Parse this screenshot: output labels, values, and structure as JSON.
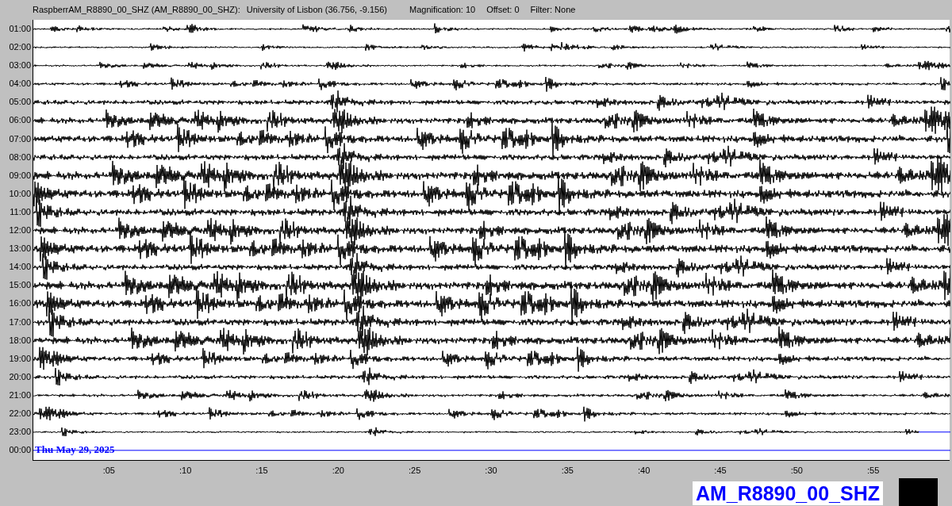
{
  "header": {
    "station": "RaspberrAM_R8890_00_SHZ (AM_R8890_00_SHZ):",
    "location": "University of Lisbon (36.756, -9.156)",
    "magnification": "Magnification: 10",
    "offset": "Offset: 0",
    "filter": "Filter: None"
  },
  "rows": [
    {
      "label": "01:00",
      "kind": "trace"
    },
    {
      "label": "02:00",
      "kind": "trace"
    },
    {
      "label": "03:00",
      "kind": "trace"
    },
    {
      "label": "04:00",
      "kind": "trace"
    },
    {
      "label": "05:00",
      "kind": "trace"
    },
    {
      "label": "06:00",
      "kind": "trace"
    },
    {
      "label": "07:00",
      "kind": "trace"
    },
    {
      "label": "08:00",
      "kind": "trace"
    },
    {
      "label": "09:00",
      "kind": "trace"
    },
    {
      "label": "10:00",
      "kind": "trace"
    },
    {
      "label": "11:00",
      "kind": "trace"
    },
    {
      "label": "12:00",
      "kind": "trace"
    },
    {
      "label": "13:00",
      "kind": "trace"
    },
    {
      "label": "14:00",
      "kind": "trace"
    },
    {
      "label": "15:00",
      "kind": "trace"
    },
    {
      "label": "16:00",
      "kind": "trace"
    },
    {
      "label": "17:00",
      "kind": "trace"
    },
    {
      "label": "18:00",
      "kind": "trace"
    },
    {
      "label": "19:00",
      "kind": "trace"
    },
    {
      "label": "20:00",
      "kind": "trace"
    },
    {
      "label": "21:00",
      "kind": "trace"
    },
    {
      "label": "22:00",
      "kind": "trace"
    },
    {
      "label": "23:00",
      "kind": "partial"
    },
    {
      "label": "00:00",
      "kind": "pending"
    }
  ],
  "date_label": "Thu May 29, 2025",
  "x_ticks": [
    ":05",
    ":10",
    ":15",
    ":20",
    ":25",
    ":30",
    ":35",
    ":40",
    ":45",
    ":50",
    ":55"
  ],
  "station_badge": "AM_R8890_00_SHZ"
}
